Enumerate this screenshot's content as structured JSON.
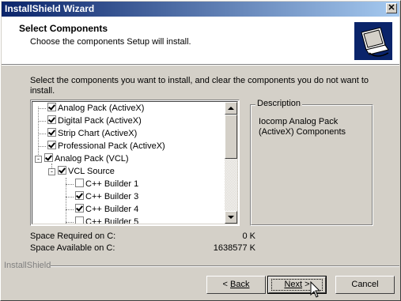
{
  "window": {
    "title": "InstallShield Wizard"
  },
  "header": {
    "title": "Select Components",
    "subtitle": "Choose the components Setup will install."
  },
  "instructions": "Select the components you want to install, and clear the components you do not want to install.",
  "tree": {
    "items": [
      {
        "label": "Analog Pack (ActiveX)",
        "checked": true,
        "level": 0
      },
      {
        "label": "Digital Pack (ActiveX)",
        "checked": true,
        "level": 0
      },
      {
        "label": "Strip Chart (ActiveX)",
        "checked": true,
        "level": 0
      },
      {
        "label": "Professional Pack (ActiveX)",
        "checked": true,
        "level": 0
      },
      {
        "label": "Analog Pack (VCL)",
        "checked": true,
        "level": 0,
        "expander": "-"
      },
      {
        "label": "VCL Source",
        "checked": true,
        "level": 1,
        "expander": "-"
      },
      {
        "label": "C++ Builder 1",
        "checked": false,
        "level": 2
      },
      {
        "label": "C++ Builder 3",
        "checked": true,
        "level": 2
      },
      {
        "label": "C++ Builder 4",
        "checked": true,
        "level": 2
      },
      {
        "label": "C++ Builder 5",
        "checked": false,
        "level": 2
      }
    ]
  },
  "description": {
    "legend": "Description",
    "text": "Iocomp Analog Pack (ActiveX) Components"
  },
  "space": {
    "required_label": "Space Required on  C:",
    "required_value": "0 K",
    "available_label": "Space Available on  C:",
    "available_value": "1638577 K"
  },
  "brand": "InstallShield",
  "buttons": {
    "back": "Back",
    "next": "Next",
    "cancel": "Cancel"
  }
}
